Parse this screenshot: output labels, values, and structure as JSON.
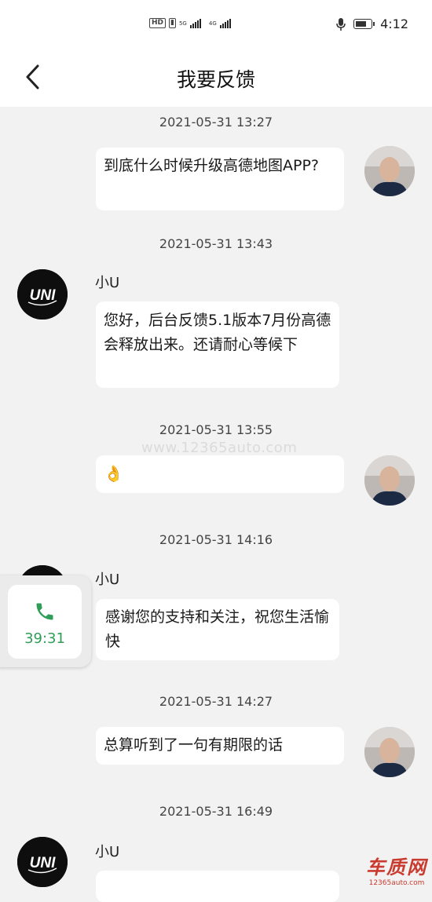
{
  "status_bar": {
    "hd": "HD",
    "net1": "5G",
    "net2": "4G",
    "time": "4:12"
  },
  "header": {
    "title": "我要反馈"
  },
  "watermark": "www.12365auto.com",
  "messages": [
    {
      "time": "2021-05-31 13:27",
      "from": "me",
      "text": "到底什么时候升级高德地图APP?"
    },
    {
      "time": "2021-05-31 13:43",
      "from": "小U",
      "text": "您好，后台反馈5.1版本7月份高德会释放出来。还请耐心等候下"
    },
    {
      "time": "2021-05-31 13:55",
      "from": "me",
      "text": "👌"
    },
    {
      "time": "2021-05-31 14:16",
      "from": "小U",
      "text": "感谢您的支持和关注，祝您生活愉快"
    },
    {
      "time": "2021-05-31 14:27",
      "from": "me",
      "text": "总算听到了一句有期限的话"
    },
    {
      "time": "2021-05-31 16:49",
      "from": "小U",
      "text": ""
    }
  ],
  "avatars": {
    "uni_logo": "UNI"
  },
  "call_widget": {
    "icon": "phone-icon",
    "duration": "39:31"
  },
  "logo": {
    "big": "车质网",
    "small": "12365auto.com"
  },
  "colors": {
    "accent_green": "#2f9e57",
    "logo_red": "#c93b2e",
    "bg": "#f2f2f2"
  }
}
